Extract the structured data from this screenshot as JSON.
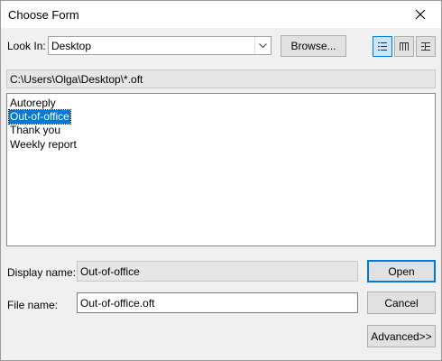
{
  "window": {
    "title": "Choose Form",
    "close_icon": "close-icon"
  },
  "look_in": {
    "label": "Look In:",
    "value": "Desktop"
  },
  "buttons": {
    "browse": "Browse...",
    "open": "Open",
    "cancel": "Cancel",
    "advanced": "Advanced>>"
  },
  "view_buttons": [
    {
      "icon": "list-view-icon",
      "active": true
    },
    {
      "icon": "details-view-icon",
      "active": false
    },
    {
      "icon": "properties-view-icon",
      "active": false
    }
  ],
  "path": "C:\\Users\\Olga\\Desktop\\*.oft",
  "files": [
    {
      "name": "Autoreply",
      "selected": false
    },
    {
      "name": "Out-of-office",
      "selected": true
    },
    {
      "name": "Thank you",
      "selected": false
    },
    {
      "name": "Weekly report",
      "selected": false
    }
  ],
  "display_name": {
    "label": "Display name:",
    "value": "Out-of-office"
  },
  "file_name": {
    "label": "File name:",
    "value": "Out-of-office.oft"
  },
  "colors": {
    "selection": "#0078d7",
    "background": "#f0f0f0"
  }
}
